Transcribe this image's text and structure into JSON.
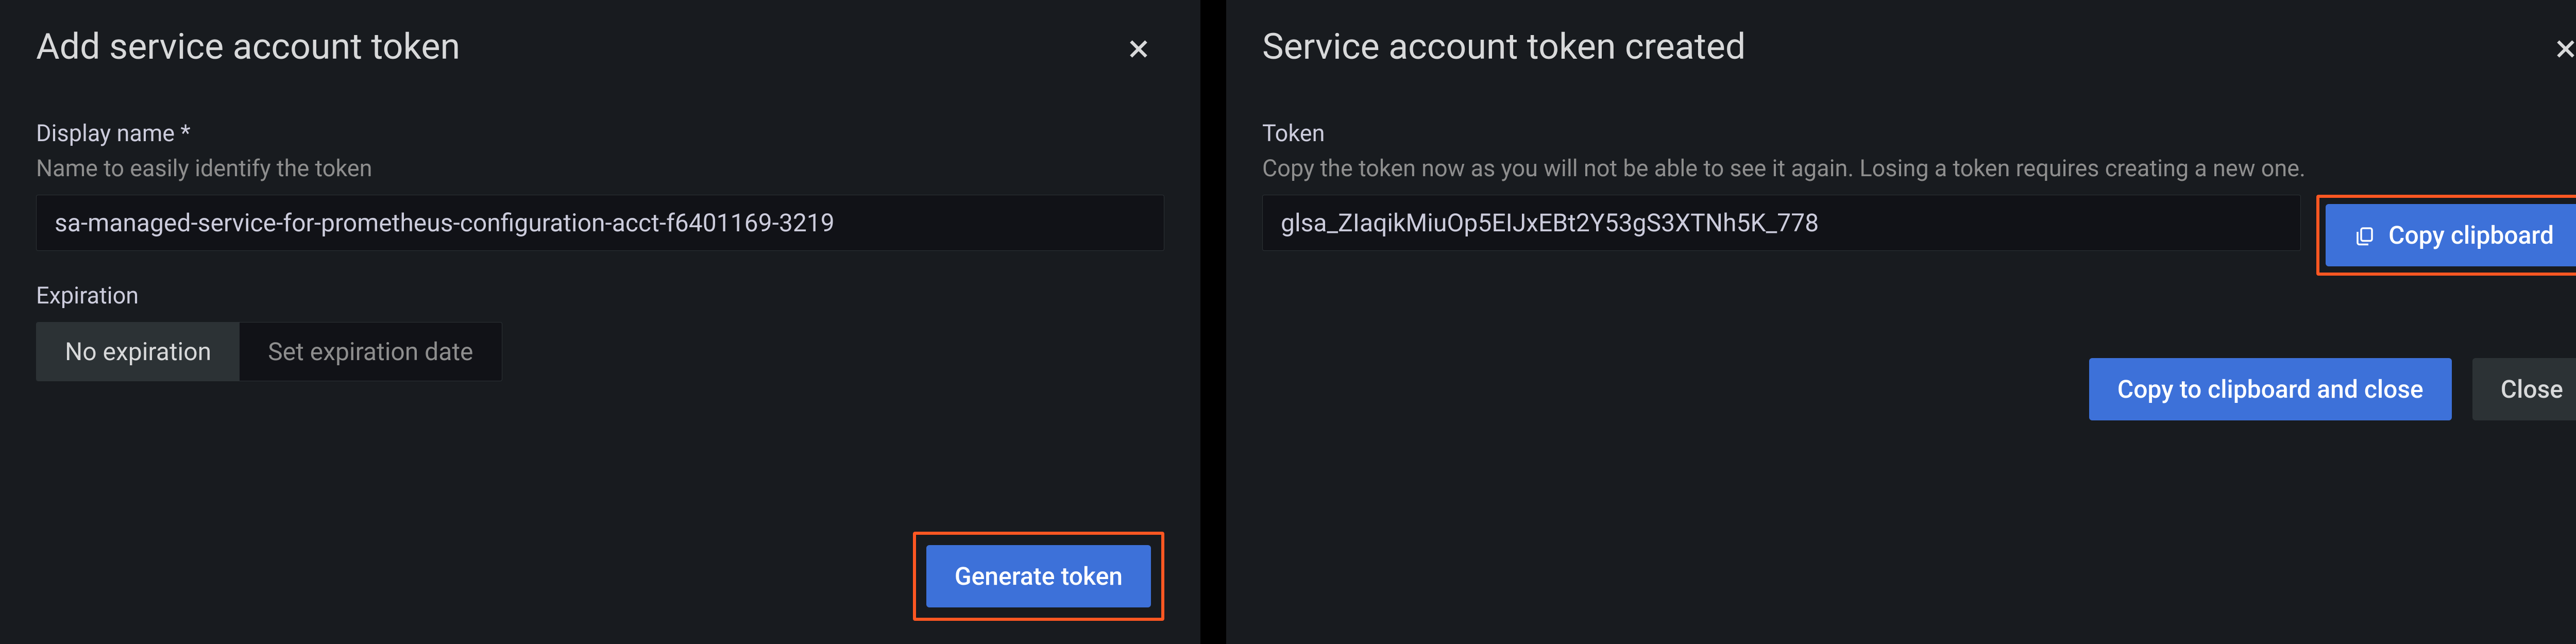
{
  "left_modal": {
    "title": "Add service account token",
    "display_name": {
      "label": "Display name *",
      "hint": "Name to easily identify the token",
      "value": "sa-managed-service-for-prometheus-configuration-acct-f6401169-3219"
    },
    "expiration": {
      "label": "Expiration",
      "no_expiration": "No expiration",
      "set_expiration": "Set expiration date"
    },
    "generate_button": "Generate token"
  },
  "right_modal": {
    "title": "Service account token created",
    "token": {
      "label": "Token",
      "hint": "Copy the token now as you will not be able to see it again. Losing a token requires creating a new one.",
      "value": "glsa_ZIaqikMiuOp5EIJxEBt2Y53gS3XTNh5K_778"
    },
    "copy_clipboard": "Copy clipboard",
    "copy_and_close": "Copy to clipboard and close",
    "close": "Close"
  }
}
